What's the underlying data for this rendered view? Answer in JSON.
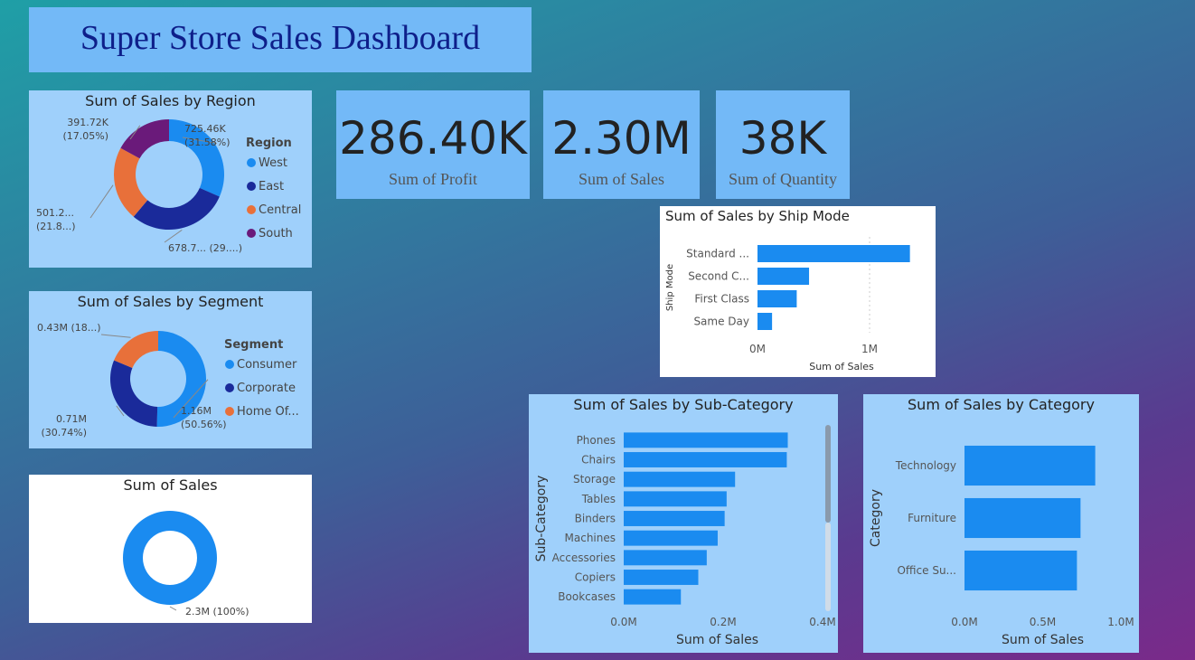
{
  "title": "Super Store Sales Dashboard",
  "colors": {
    "blue": "#1a8bf0",
    "navy": "#1a2a9a",
    "orange": "#e8703a",
    "purple": "#6a1a7a"
  },
  "kpis": [
    {
      "value": "286.40K",
      "label": "Sum of Profit"
    },
    {
      "value": "2.30M",
      "label": "Sum of Sales"
    },
    {
      "value": "38K",
      "label": "Sum of Quantity"
    }
  ],
  "chart_data": [
    {
      "id": "region",
      "type": "pie",
      "title": "Sum of Sales by Region",
      "legend_title": "Region",
      "legend": "right",
      "slices": [
        {
          "label": "West",
          "value": 725.46,
          "color": "#1a8bf0",
          "data_label": [
            "725.46K",
            "(31.58%)"
          ]
        },
        {
          "label": "East",
          "value": 678.7,
          "color": "#1a2a9a",
          "data_label": [
            "678.7... (29....)"
          ]
        },
        {
          "label": "Central",
          "value": 501.2,
          "color": "#e8703a",
          "data_label": [
            "501.2...",
            "(21.8...)"
          ]
        },
        {
          "label": "South",
          "value": 391.72,
          "color": "#6a1a7a",
          "data_label": [
            "391.72K",
            "(17.05%)"
          ]
        }
      ]
    },
    {
      "id": "segment",
      "type": "pie",
      "title": "Sum of Sales by Segment",
      "legend_title": "Segment",
      "legend": "right",
      "slices": [
        {
          "label": "Consumer",
          "value": 1.16,
          "color": "#1a8bf0",
          "data_label": [
            "1.16M",
            "(50.56%)"
          ]
        },
        {
          "label": "Corporate",
          "value": 0.71,
          "color": "#1a2a9a",
          "data_label": [
            "0.71M",
            "(30.74%)"
          ]
        },
        {
          "label": "Home Of...",
          "value": 0.43,
          "color": "#e8703a",
          "data_label": [
            "0.43M (18...)"
          ]
        }
      ]
    },
    {
      "id": "total",
      "type": "pie",
      "title": "Sum of Sales",
      "slices": [
        {
          "label": "Sales",
          "value": 2.3,
          "color": "#1a8bf0",
          "data_label": [
            "2.3M (100%)"
          ]
        }
      ]
    },
    {
      "id": "shipmode",
      "type": "bar",
      "orientation": "horizontal",
      "title": "Sum of Sales by Ship Mode",
      "xlabel": "Sum of Sales",
      "ylabel": "Ship Mode",
      "categories": [
        "Standard ...",
        "Second C...",
        "First Class",
        "Same Day"
      ],
      "values": [
        1.36,
        0.46,
        0.35,
        0.13
      ],
      "xlim": [
        0,
        1.5
      ],
      "ticks": [
        {
          "v": 0,
          "label": "0M"
        },
        {
          "v": 1,
          "label": "1M"
        }
      ]
    },
    {
      "id": "subcategory",
      "type": "bar",
      "orientation": "horizontal",
      "title": "Sum of Sales by Sub-Category",
      "xlabel": "Sum of Sales",
      "ylabel": "Sub-Category",
      "categories": [
        "Phones",
        "Chairs",
        "Storage",
        "Tables",
        "Binders",
        "Machines",
        "Accessories",
        "Copiers",
        "Bookcases"
      ],
      "values": [
        0.33,
        0.328,
        0.224,
        0.207,
        0.203,
        0.189,
        0.167,
        0.15,
        0.115
      ],
      "xlim": [
        0,
        0.42
      ],
      "ticks": [
        {
          "v": 0,
          "label": "0.0M"
        },
        {
          "v": 0.2,
          "label": "0.2M"
        },
        {
          "v": 0.4,
          "label": "0.4M"
        }
      ]
    },
    {
      "id": "category",
      "type": "bar",
      "orientation": "horizontal",
      "title": "Sum of Sales by Category",
      "xlabel": "Sum of Sales",
      "ylabel": "Category",
      "categories": [
        "Technology",
        "Furniture",
        "Office Su..."
      ],
      "values": [
        0.836,
        0.742,
        0.719
      ],
      "xlim": [
        0,
        1.0
      ],
      "ticks": [
        {
          "v": 0,
          "label": "0.0M"
        },
        {
          "v": 0.5,
          "label": "0.5M"
        },
        {
          "v": 1,
          "label": "1.0M"
        }
      ]
    }
  ]
}
